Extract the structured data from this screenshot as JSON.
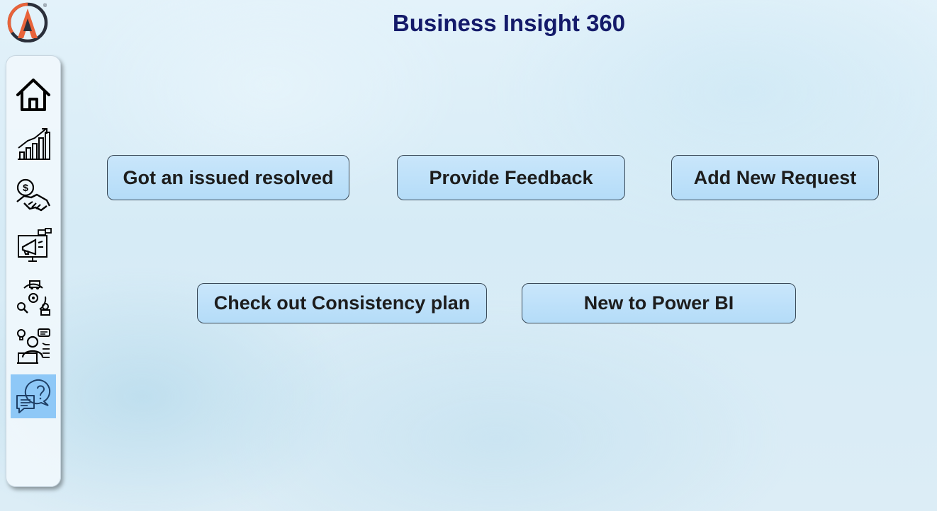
{
  "app": {
    "title": "Business Insight 360"
  },
  "logo": {
    "icon": "brand-logo-icon",
    "mark": "®",
    "colors": {
      "dark": "#2b2f3a",
      "accent": "#e8633a"
    }
  },
  "sidebar": {
    "items": [
      {
        "icon": "home-icon"
      },
      {
        "icon": "growth-chart-icon"
      },
      {
        "icon": "finance-handshake-icon"
      },
      {
        "icon": "marketing-megaphone-icon"
      },
      {
        "icon": "supply-chain-icon"
      },
      {
        "icon": "executive-icon"
      },
      {
        "icon": "support-chat-icon",
        "active": true
      }
    ],
    "active_color": "#8ec8f7"
  },
  "actions": {
    "issue_resolved": "Got an issued resolved",
    "provide_feedback": "Provide Feedback",
    "add_request": "Add New Request",
    "consistency_plan": "Check out Consistency plan",
    "new_to_powerbi": "New to Power BI"
  },
  "colors": {
    "title": "#141a6a",
    "button_fill": "#b9def9",
    "button_border": "#3a4a58"
  }
}
